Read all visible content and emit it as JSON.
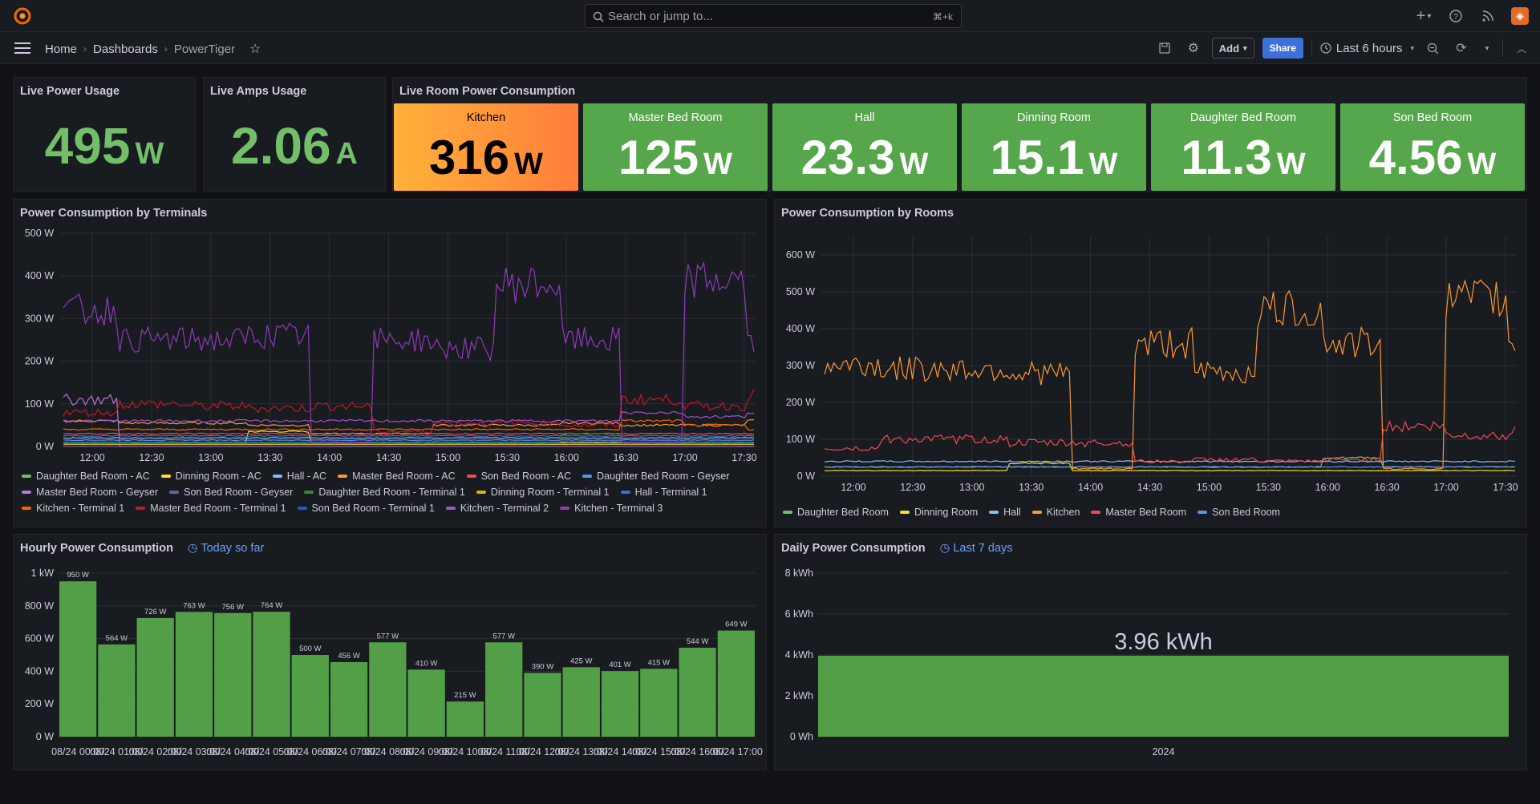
{
  "topbar": {
    "search_placeholder": "Search or jump to...",
    "search_shortcut": "⌘+k",
    "icons": [
      "plus-icon",
      "help-icon",
      "rss-icon",
      "avatar"
    ]
  },
  "nav": {
    "crumbs": [
      "Home",
      "Dashboards",
      "PowerTiger"
    ],
    "add_label": "Add",
    "share_label": "Share",
    "time_range": "Last 6 hours"
  },
  "stats": {
    "power": {
      "title": "Live Power Usage",
      "value": "495",
      "unit": "W"
    },
    "amps": {
      "title": "Live Amps Usage",
      "value": "2.06",
      "unit": "A"
    }
  },
  "rooms_panel": {
    "title": "Live Room Power Consumption",
    "tiles": [
      {
        "name": "Kitchen",
        "value": "316",
        "unit": "W",
        "color": "#ff9830"
      },
      {
        "name": "Master Bed Room",
        "value": "125",
        "unit": "W",
        "color": "#56a64b"
      },
      {
        "name": "Hall",
        "value": "23.3",
        "unit": "W",
        "color": "#56a64b"
      },
      {
        "name": "Dinning Room",
        "value": "15.1",
        "unit": "W",
        "color": "#56a64b"
      },
      {
        "name": "Daughter Bed Room",
        "value": "11.3",
        "unit": "W",
        "color": "#56a64b"
      },
      {
        "name": "Son Bed Room",
        "value": "4.56",
        "unit": "W",
        "color": "#56a64b"
      }
    ]
  },
  "terminals_panel": {
    "title": "Power Consumption by Terminals"
  },
  "rooms_chart_panel": {
    "title": "Power Consumption by Rooms"
  },
  "hourly_panel": {
    "title": "Hourly Power Consumption",
    "time_info": "Today so far"
  },
  "daily_panel": {
    "title": "Daily Power Consumption",
    "time_info": "Last 7 days"
  },
  "chart_data": [
    {
      "type": "line",
      "title": "Power Consumption by Terminals",
      "x_ticks": [
        "12:00",
        "12:30",
        "13:00",
        "13:30",
        "14:00",
        "14:30",
        "15:00",
        "15:30",
        "16:00",
        "16:30",
        "17:00",
        "17:30"
      ],
      "y_ticks": [
        "0 W",
        "100 W",
        "200 W",
        "300 W",
        "400 W",
        "500 W"
      ],
      "ylim": [
        0,
        500
      ],
      "series": [
        {
          "name": "Daughter Bed Room - AC",
          "color": "#73bf69",
          "values": [
            5,
            5,
            5,
            5,
            5,
            5,
            5,
            5,
            5,
            5,
            5,
            5
          ]
        },
        {
          "name": "Dinning Room - AC",
          "color": "#fade2a",
          "values": [
            10,
            10,
            10,
            35,
            10,
            10,
            10,
            10,
            10,
            10,
            10,
            10
          ]
        },
        {
          "name": "Hall - AC",
          "color": "#8ab8ff",
          "values": [
            20,
            20,
            20,
            20,
            20,
            20,
            20,
            20,
            20,
            20,
            20,
            20
          ]
        },
        {
          "name": "Master Bed Room - AC",
          "color": "#ff9830",
          "values": [
            60,
            55,
            55,
            50,
            30,
            30,
            50,
            50,
            55,
            50,
            50,
            60
          ]
        },
        {
          "name": "Son Bed Room - AC",
          "color": "#f2495c",
          "values": [
            30,
            30,
            30,
            30,
            30,
            30,
            30,
            30,
            30,
            30,
            30,
            30
          ]
        },
        {
          "name": "Daughter Bed Room - Geyser",
          "color": "#5794f2",
          "values": [
            15,
            15,
            15,
            15,
            15,
            15,
            15,
            15,
            15,
            15,
            15,
            15
          ]
        },
        {
          "name": "Master Bed Room - Geyser",
          "color": "#b877d9",
          "values": [
            110,
            0,
            0,
            0,
            0,
            0,
            0,
            0,
            0,
            0,
            0,
            0
          ]
        },
        {
          "name": "Son Bed Room - Geyser",
          "color": "#705da0",
          "values": [
            0,
            0,
            0,
            0,
            0,
            0,
            0,
            0,
            0,
            0,
            0,
            0
          ]
        },
        {
          "name": "Daughter Bed Room - Terminal 1",
          "color": "#37872d",
          "values": [
            10,
            10,
            10,
            10,
            10,
            10,
            10,
            10,
            30,
            10,
            10,
            10
          ]
        },
        {
          "name": "Dinning Room - Terminal 1",
          "color": "#e0b400",
          "values": [
            5,
            5,
            5,
            5,
            5,
            5,
            5,
            5,
            5,
            5,
            5,
            5
          ]
        },
        {
          "name": "Hall - Terminal 1",
          "color": "#3274d9",
          "values": [
            25,
            25,
            25,
            25,
            25,
            25,
            25,
            25,
            25,
            25,
            25,
            25
          ]
        },
        {
          "name": "Kitchen - Terminal 1",
          "color": "#fa6400",
          "values": [
            40,
            40,
            40,
            40,
            40,
            40,
            40,
            40,
            40,
            60,
            50,
            40
          ]
        },
        {
          "name": "Master Bed Room - Terminal 1",
          "color": "#c4162a",
          "values": [
            80,
            100,
            95,
            90,
            95,
            35,
            55,
            55,
            50,
            110,
            95,
            120
          ]
        },
        {
          "name": "Son Bed Room - Terminal 1",
          "color": "#1f60c4",
          "values": [
            8,
            8,
            8,
            8,
            8,
            8,
            8,
            8,
            8,
            8,
            8,
            8
          ]
        },
        {
          "name": "Kitchen - Terminal 2",
          "color": "#a352cc",
          "values": [
            60,
            60,
            60,
            60,
            60,
            60,
            60,
            60,
            60,
            80,
            70,
            80
          ]
        },
        {
          "name": "Kitchen - Terminal 3",
          "color": "#8f3bb8",
          "values": [
            320,
            250,
            250,
            260,
            10,
            250,
            230,
            380,
            250,
            10,
            390,
            240
          ]
        }
      ]
    },
    {
      "type": "line",
      "title": "Power Consumption by Rooms",
      "x_ticks": [
        "12:00",
        "12:30",
        "13:00",
        "13:30",
        "14:00",
        "14:30",
        "15:00",
        "15:30",
        "16:00",
        "16:30",
        "17:00",
        "17:30"
      ],
      "y_ticks": [
        "0 W",
        "100 W",
        "200 W",
        "300 W",
        "400 W",
        "500 W",
        "600 W"
      ],
      "ylim": [
        0,
        650
      ],
      "series": [
        {
          "name": "Daughter Bed Room",
          "color": "#73bf69",
          "values": [
            25,
            25,
            25,
            25,
            25,
            25,
            25,
            25,
            50,
            25,
            25,
            25
          ]
        },
        {
          "name": "Dinning Room",
          "color": "#fade2a",
          "values": [
            15,
            15,
            15,
            35,
            15,
            15,
            15,
            15,
            15,
            15,
            15,
            15
          ]
        },
        {
          "name": "Hall",
          "color": "#8ab8ff",
          "values": [
            40,
            40,
            40,
            40,
            40,
            40,
            40,
            40,
            40,
            40,
            40,
            40
          ]
        },
        {
          "name": "Kitchen",
          "color": "#ff9830",
          "values": [
            300,
            290,
            290,
            280,
            20,
            360,
            280,
            450,
            360,
            20,
            480,
            360
          ]
        },
        {
          "name": "Master Bed Room",
          "color": "#f2495c",
          "values": [
            75,
            100,
            100,
            90,
            90,
            40,
            45,
            40,
            45,
            135,
            110,
            125
          ]
        },
        {
          "name": "Son Bed Room",
          "color": "#5794f2",
          "values": [
            25,
            25,
            25,
            25,
            25,
            25,
            25,
            25,
            25,
            25,
            25,
            25
          ]
        }
      ]
    },
    {
      "type": "bar",
      "title": "Hourly Power Consumption",
      "categories": [
        "08/24 00:00",
        "08/24 01:00",
        "08/24 02:00",
        "08/24 03:00",
        "08/24 04:00",
        "08/24 05:00",
        "08/24 06:00",
        "08/24 07:00",
        "08/24 08:00",
        "08/24 09:00",
        "08/24 10:00",
        "08/24 11:00",
        "08/24 12:00",
        "08/24 13:00",
        "08/24 14:00",
        "08/24 15:00",
        "08/24 16:00",
        "08/24 17:00"
      ],
      "values": [
        950,
        564,
        726,
        763,
        756,
        764,
        500,
        456,
        577,
        410,
        215,
        577,
        390,
        425,
        401,
        415,
        544,
        649
      ],
      "labels": [
        "950 W",
        "564 W",
        "726 W",
        "763 W",
        "756 W",
        "764 W",
        "500 W",
        "456 W",
        "577 W",
        "410 W",
        "215 W",
        "577 W",
        "390 W",
        "425 W",
        "401 W",
        "415 W",
        "544 W",
        "649 W"
      ],
      "y_ticks": [
        "0 W",
        "200 W",
        "400 W",
        "600 W",
        "800 W",
        "1 kW"
      ],
      "ylim": [
        0,
        1000
      ],
      "color": "#56a64b"
    },
    {
      "type": "bar",
      "title": "Daily Power Consumption",
      "categories": [
        "2024"
      ],
      "values": [
        3.96
      ],
      "labels": [
        "3.96 kWh"
      ],
      "y_ticks": [
        "0 Wh",
        "2 kWh",
        "4 kWh",
        "6 kWh",
        "8 kWh"
      ],
      "ylim": [
        0,
        8
      ],
      "color": "#56a64b"
    }
  ]
}
